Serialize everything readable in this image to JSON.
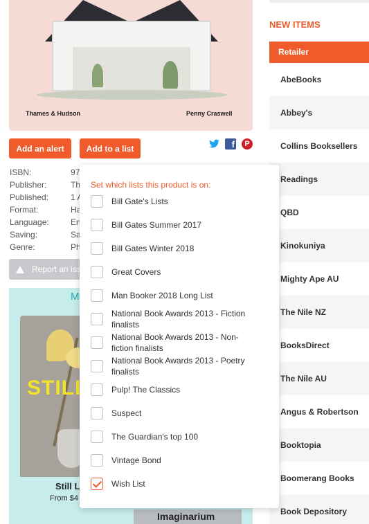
{
  "cover": {
    "publisher": "Thames & Hudson",
    "author": "Penny Craswell"
  },
  "actions": {
    "add_alert": "Add an alert",
    "add_list": "Add to a list"
  },
  "share": {
    "twitter_icon": "twitter-icon",
    "facebook_glyph": "f",
    "pinterest_glyph": "P"
  },
  "details": [
    {
      "label": "ISBN:",
      "value": "97"
    },
    {
      "label": "Publisher:",
      "value": "Th"
    },
    {
      "label": "Published:",
      "value": "1 A"
    },
    {
      "label": "Format:",
      "value": "Ha"
    },
    {
      "label": "Language:",
      "value": "En"
    },
    {
      "label": "Saving:",
      "value": "Sa"
    },
    {
      "label": "Genre:",
      "value": "Ph"
    }
  ],
  "report": {
    "label": "Report an iss"
  },
  "more": {
    "title": "M"
  },
  "books": [
    {
      "cover_text": "STILL",
      "title": "Still L",
      "price": "From $4"
    },
    {
      "title": "Imaginarium"
    }
  ],
  "dropdown": {
    "header": "Set which lists this product is on:",
    "items": [
      {
        "label": "Bill Gate's Lists",
        "checked": false
      },
      {
        "label": "Bill Gates Summer 2017",
        "checked": false
      },
      {
        "label": "Bill Gates Winter 2018",
        "checked": false
      },
      {
        "label": "Great Covers",
        "checked": false
      },
      {
        "label": "Man Booker 2018 Long List",
        "checked": false
      },
      {
        "label": "National Book Awards 2013 - Fiction finalists",
        "checked": false
      },
      {
        "label": "National Book Awards 2013 - Non-fiction finalists",
        "checked": false
      },
      {
        "label": "National Book Awards 2013 - Poetry finalists",
        "checked": false
      },
      {
        "label": "Pulp! The Classics",
        "checked": false
      },
      {
        "label": "Suspect",
        "checked": false
      },
      {
        "label": "The Guardian's top 100",
        "checked": false
      },
      {
        "label": "Vintage Bond",
        "checked": false
      },
      {
        "label": "Wish List",
        "checked": true
      }
    ]
  },
  "sidebar": {
    "new_items": "NEW ITEMS",
    "header": "Retailer",
    "retailers": [
      "AbeBooks",
      "Abbey's",
      "Collins Booksellers",
      "Readings",
      "QBD",
      "Kinokuniya",
      "Mighty Ape AU",
      "The Nile NZ",
      "BooksDirect",
      "The Nile AU",
      "Angus & Robertson",
      "Booktopia",
      "Boomerang Books",
      "Book Depository"
    ]
  },
  "colors": {
    "accent": "#ef5b2a",
    "teal": "#1ab0b0",
    "panel": "#c7ecec"
  }
}
